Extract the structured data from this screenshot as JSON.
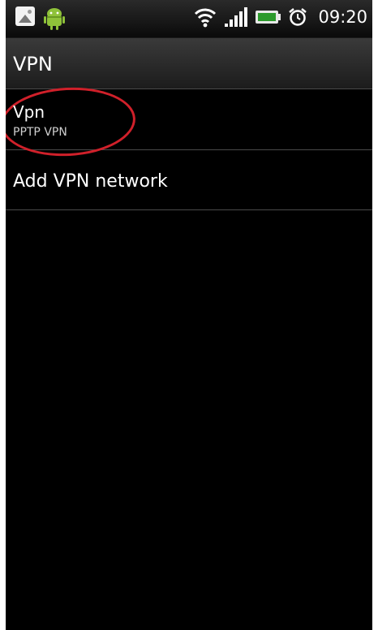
{
  "status_bar": {
    "time": "09:20",
    "icons": [
      "gallery-icon",
      "android-icon",
      "wifi-icon",
      "signal-icon",
      "battery-icon",
      "alarm-icon"
    ]
  },
  "header": {
    "title": "VPN"
  },
  "list": {
    "vpn_item": {
      "title": "Vpn",
      "subtitle": "PPTP VPN"
    },
    "add_item": {
      "title": "Add VPN network"
    }
  },
  "colors": {
    "background": "#000000",
    "highlight_circle": "#d0202a",
    "divider": "#4a4a4a"
  }
}
